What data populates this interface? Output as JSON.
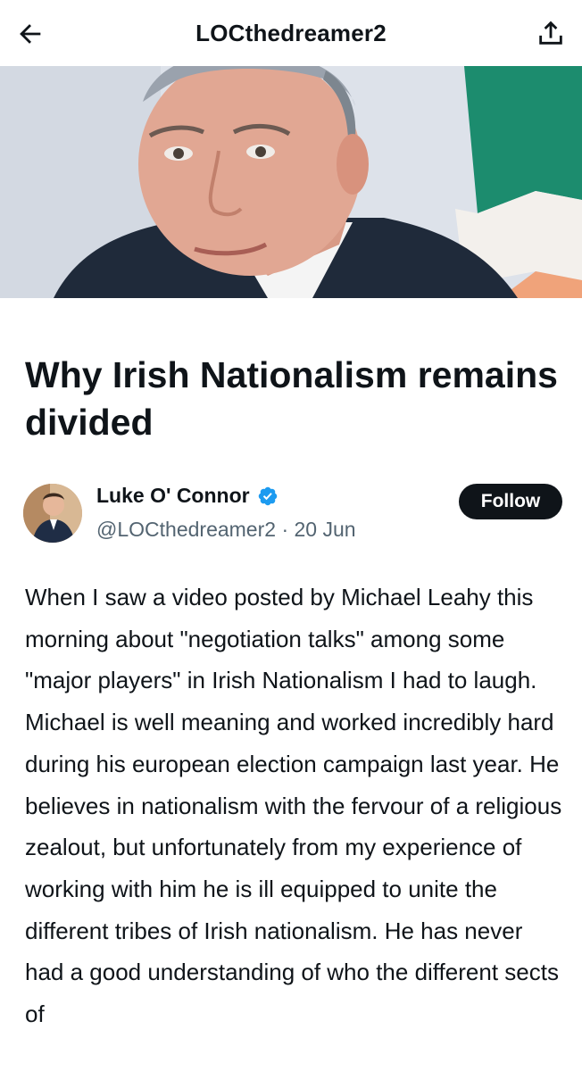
{
  "topbar": {
    "title": "LOCthedreamer2",
    "back_icon": "arrow-left-icon",
    "share_icon": "share-upload-icon"
  },
  "hero": {
    "description_icon": "header-image"
  },
  "article": {
    "title": "Why Irish Nationalism remains divided"
  },
  "author": {
    "name": "Luke O' Connor",
    "handle": "@LOCthedreamer2",
    "separator": "·",
    "date": "20 Jun",
    "verified_icon": "verified-badge-icon",
    "follow_label": "Follow"
  },
  "body": {
    "text": "When I saw a video posted by Michael Leahy this morning about \"negotiation talks\" among some \"major players\" in Irish Nationalism I had to laugh. Michael is well meaning and worked incredibly hard during his european election campaign last year. He believes in nationalism with the fervour of a religious zealout, but unfortunately from my experience of working with him he is ill equipped to unite the different tribes of Irish nationalism. He has never had a good understanding of who the different sects of"
  },
  "colors": {
    "text": "#0f1419",
    "secondary": "#536471",
    "verified": "#1d9bf0",
    "button": "#0f1419"
  }
}
